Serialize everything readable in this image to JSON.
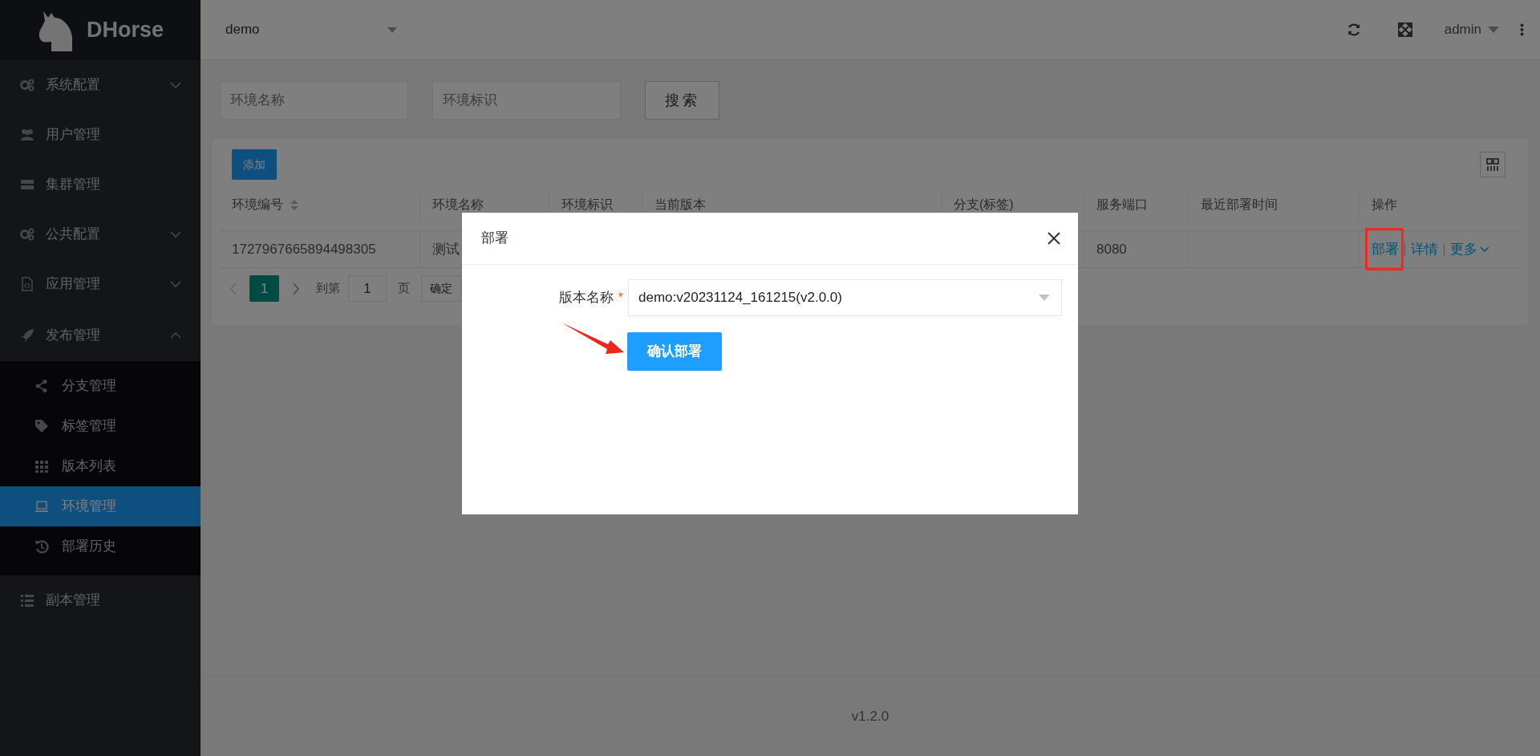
{
  "app": {
    "logo": "DHorse"
  },
  "sidebar": {
    "items": [
      {
        "label": "系统配置",
        "expanded": false,
        "selected": false
      },
      {
        "label": "用户管理",
        "selected": false
      },
      {
        "label": "集群管理",
        "selected": false
      },
      {
        "label": "公共配置",
        "expanded": false,
        "selected": false
      },
      {
        "label": "应用管理",
        "expanded": false,
        "selected": false
      },
      {
        "label": "发布管理",
        "expanded": true,
        "selected": false,
        "children": [
          {
            "label": "分支管理",
            "selected": false
          },
          {
            "label": "标签管理",
            "selected": false
          },
          {
            "label": "版本列表",
            "selected": false
          },
          {
            "label": "环境管理",
            "selected": true
          },
          {
            "label": "部署历史",
            "selected": false
          }
        ]
      },
      {
        "label": "副本管理",
        "selected": false
      }
    ]
  },
  "header": {
    "project_select": {
      "value": "demo"
    },
    "user": "admin"
  },
  "search": {
    "fields": [
      {
        "placeholder": "环境名称"
      },
      {
        "placeholder": "环境标识"
      }
    ],
    "button": "搜索"
  },
  "table": {
    "add_button": "添加",
    "columns": [
      {
        "label": "环境编号",
        "sortable": true
      },
      {
        "label": "环境名称"
      },
      {
        "label": "环境标识"
      },
      {
        "label": "当前版本"
      },
      {
        "label": "分支(标签)"
      },
      {
        "label": "服务端口"
      },
      {
        "label": "最近部署时间"
      },
      {
        "label": "操作"
      }
    ],
    "rows": [
      {
        "env_id": "1727967665894498305",
        "env_name": "测试",
        "port": "8080",
        "actions": [
          {
            "label": "部署",
            "kind": "link",
            "annotated": true
          },
          {
            "label": "详情",
            "kind": "link"
          },
          {
            "label": "更多",
            "kind": "dropdown"
          }
        ]
      }
    ],
    "pagination": {
      "current": "1",
      "goto_label": "到第",
      "goto_value": "1",
      "page_label": "页",
      "confirm": "确定"
    }
  },
  "footer": {
    "version": "v1.2.0"
  },
  "modal": {
    "title": "部署",
    "field": {
      "label": "版本名称",
      "required_mark": "*",
      "value": "demo:v20231124_161215(v2.0.0)"
    },
    "button": "确认部署",
    "annotation_arrow": true
  }
}
